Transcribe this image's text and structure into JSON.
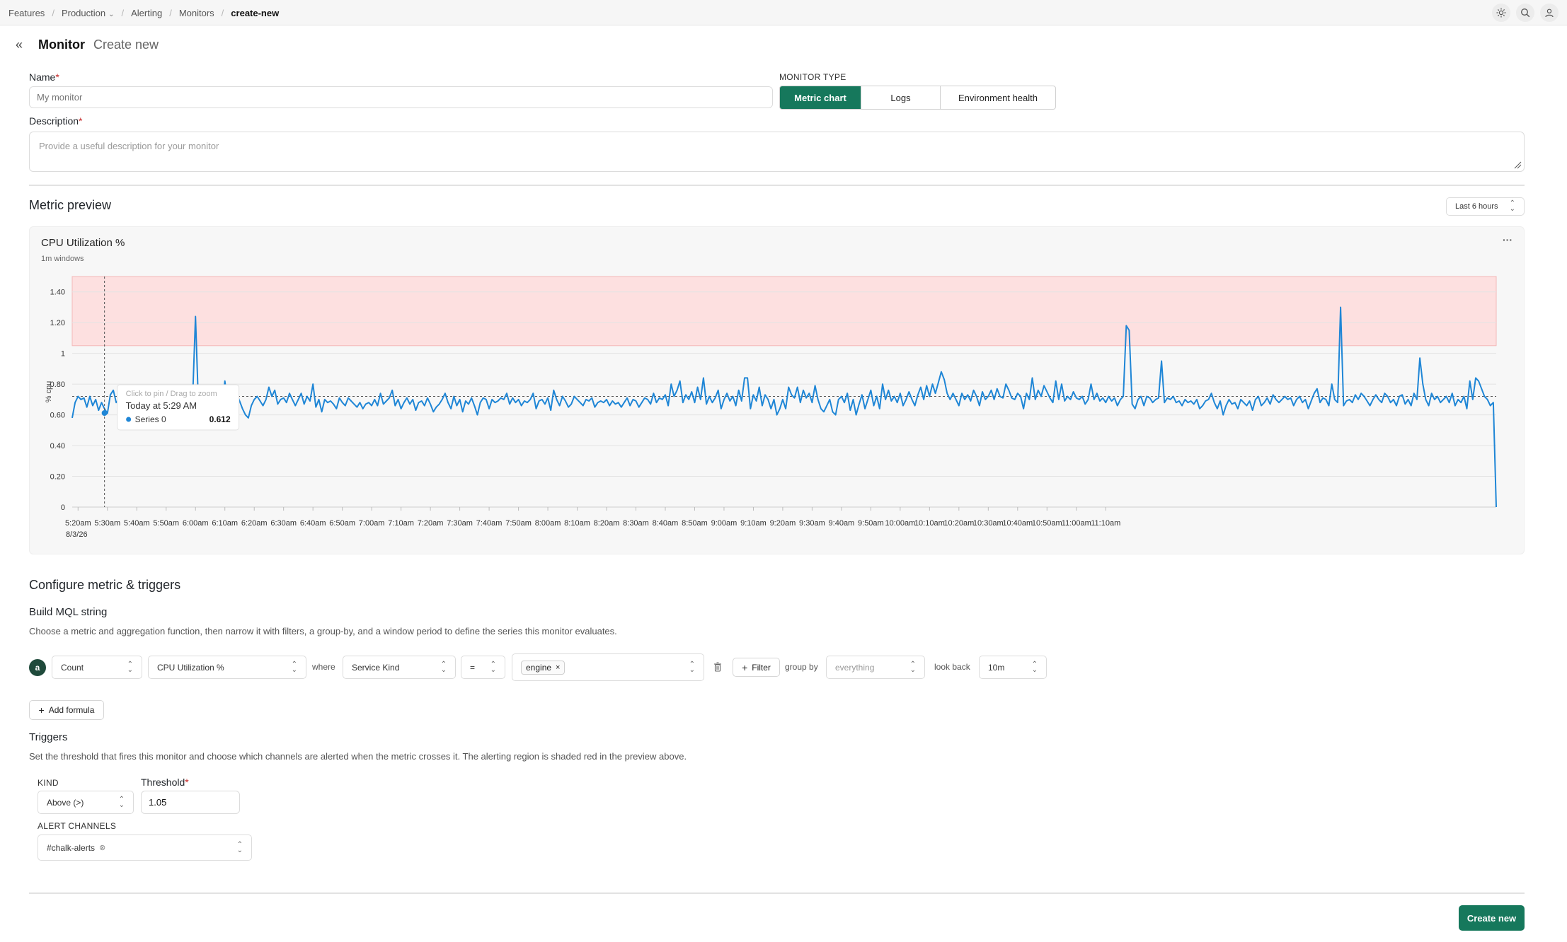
{
  "breadcrumbs": [
    {
      "label": "Features"
    },
    {
      "label": "Production"
    },
    {
      "label": "Alerting"
    },
    {
      "label": "Monitors"
    },
    {
      "label": "create-new"
    }
  ],
  "header": {
    "title": "Monitor",
    "subtitle": "Create new"
  },
  "form": {
    "name_label": "Name",
    "name_placeholder": "My monitor",
    "monitor_type_label": "MONITOR TYPE",
    "monitor_types": [
      "Metric chart",
      "Logs",
      "Environment health"
    ],
    "monitor_type_selected": "Metric chart",
    "description_label": "Description",
    "description_placeholder": "Provide a useful description for your monitor",
    "required_mark": "*"
  },
  "preview": {
    "title": "Metric preview",
    "range": "Last 6 hours",
    "more": "···"
  },
  "chart_data": {
    "type": "line",
    "title": "CPU Utilization %",
    "subtitle": "1m windows",
    "ylabel": "% cpu",
    "xlabel": "",
    "ylim": [
      0,
      1.5
    ],
    "yticks": [
      "0",
      "0.20",
      "0.40",
      "0.60",
      "0.80",
      "1",
      "1.20",
      "1.40"
    ],
    "xticks": [
      "5:20am",
      "5:30am",
      "5:40am",
      "5:50am",
      "6:00am",
      "6:10am",
      "6:20am",
      "6:30am",
      "6:40am",
      "6:50am",
      "7:00am",
      "7:10am",
      "7:20am",
      "7:30am",
      "7:40am",
      "7:50am",
      "8:00am",
      "8:10am",
      "8:20am",
      "8:30am",
      "8:40am",
      "8:50am",
      "9:00am",
      "9:10am",
      "9:20am",
      "9:30am",
      "9:40am",
      "9:50am",
      "10:00am",
      "10:10am",
      "10:20am",
      "10:30am",
      "10:40am",
      "10:50am",
      "11:00am",
      "11:10am"
    ],
    "xdate": "8/3/26",
    "threshold_band": [
      1.05,
      1.5
    ],
    "reference_line": 0.72,
    "grid": true,
    "x_start_time": "5:18am",
    "minutes_per_point": 1,
    "series": [
      {
        "name": "Series 0",
        "color": "#1f86d6",
        "values": [
          0.58,
          0.68,
          0.72,
          0.7,
          0.71,
          0.65,
          0.72,
          0.66,
          0.7,
          0.63,
          0.68,
          0.64,
          0.61,
          0.73,
          0.76,
          0.68,
          0.7,
          0.64,
          0.67,
          0.72,
          0.69,
          0.66,
          0.72,
          0.7,
          0.68,
          0.74,
          0.63,
          0.71,
          0.68,
          0.66,
          0.7,
          0.64,
          0.69,
          0.73,
          0.66,
          0.68,
          0.67,
          0.71,
          0.65,
          0.68,
          0.64,
          0.7,
          1.24,
          0.66,
          0.62,
          0.66,
          0.6,
          0.78,
          0.62,
          0.7,
          0.66,
          0.64,
          0.82,
          0.67,
          0.6,
          0.7,
          0.74,
          0.69,
          0.64,
          0.6,
          0.58,
          0.66,
          0.7,
          0.72,
          0.69,
          0.66,
          0.7,
          0.78,
          0.72,
          0.76,
          0.67,
          0.7,
          0.71,
          0.68,
          0.74,
          0.7,
          0.66,
          0.7,
          0.74,
          0.67,
          0.72,
          0.69,
          0.8,
          0.65,
          0.7,
          0.62,
          0.7,
          0.68,
          0.69,
          0.67,
          0.64,
          0.71,
          0.68,
          0.66,
          0.71,
          0.69,
          0.67,
          0.65,
          0.68,
          0.64,
          0.67,
          0.68,
          0.66,
          0.7,
          0.66,
          0.74,
          0.67,
          0.69,
          0.71,
          0.76,
          0.66,
          0.7,
          0.64,
          0.68,
          0.71,
          0.67,
          0.7,
          0.63,
          0.68,
          0.69,
          0.66,
          0.71,
          0.67,
          0.62,
          0.65,
          0.67,
          0.7,
          0.74,
          0.68,
          0.64,
          0.72,
          0.66,
          0.7,
          0.62,
          0.69,
          0.67,
          0.71,
          0.66,
          0.6,
          0.68,
          0.71,
          0.7,
          0.64,
          0.7,
          0.68,
          0.69,
          0.71,
          0.7,
          0.74,
          0.67,
          0.71,
          0.68,
          0.7,
          0.66,
          0.69,
          0.68,
          0.7,
          0.74,
          0.64,
          0.69,
          0.7,
          0.67,
          0.71,
          0.63,
          0.76,
          0.7,
          0.66,
          0.72,
          0.69,
          0.65,
          0.67,
          0.72,
          0.7,
          0.68,
          0.66,
          0.7,
          0.69,
          0.71,
          0.65,
          0.68,
          0.69,
          0.68,
          0.7,
          0.66,
          0.69,
          0.67,
          0.68,
          0.65,
          0.68,
          0.71,
          0.66,
          0.7,
          0.69,
          0.65,
          0.68,
          0.71,
          0.7,
          0.67,
          0.74,
          0.68,
          0.71,
          0.7,
          0.73,
          0.66,
          0.8,
          0.72,
          0.76,
          0.82,
          0.68,
          0.73,
          0.7,
          0.75,
          0.68,
          0.78,
          0.7,
          0.84,
          0.67,
          0.72,
          0.68,
          0.71,
          0.76,
          0.64,
          0.7,
          0.74,
          0.69,
          0.72,
          0.66,
          0.76,
          0.69,
          0.84,
          0.84,
          0.64,
          0.73,
          0.69,
          0.78,
          0.66,
          0.73,
          0.7,
          0.64,
          0.7,
          0.6,
          0.64,
          0.7,
          0.64,
          0.78,
          0.73,
          0.71,
          0.78,
          0.68,
          0.76,
          0.71,
          0.74,
          0.68,
          0.79,
          0.7,
          0.64,
          0.62,
          0.66,
          0.7,
          0.62,
          0.6,
          0.7,
          0.72,
          0.68,
          0.74,
          0.63,
          0.7,
          0.6,
          0.67,
          0.73,
          0.64,
          0.7,
          0.76,
          0.66,
          0.72,
          0.64,
          0.8,
          0.7,
          0.76,
          0.69,
          0.72,
          0.68,
          0.74,
          0.66,
          0.7,
          0.75,
          0.7,
          0.66,
          0.73,
          0.78,
          0.7,
          0.79,
          0.72,
          0.8,
          0.74,
          0.81,
          0.88,
          0.83,
          0.74,
          0.7,
          0.74,
          0.7,
          0.66,
          0.74,
          0.7,
          0.73,
          0.69,
          0.76,
          0.72,
          0.66,
          0.75,
          0.7,
          0.72,
          0.76,
          0.7,
          0.77,
          0.72,
          0.71,
          0.8,
          0.76,
          0.71,
          0.7,
          0.74,
          0.72,
          0.64,
          0.74,
          0.7,
          0.84,
          0.7,
          0.76,
          0.72,
          0.79,
          0.75,
          0.71,
          0.68,
          0.82,
          0.7,
          0.8,
          0.69,
          0.72,
          0.7,
          0.75,
          0.71,
          0.7,
          0.72,
          0.67,
          0.7,
          0.8,
          0.7,
          0.74,
          0.69,
          0.71,
          0.68,
          0.72,
          0.69,
          0.71,
          0.66,
          0.7,
          0.72,
          1.18,
          1.15,
          0.67,
          0.64,
          0.7,
          0.72,
          0.66,
          0.72,
          0.71,
          0.68,
          0.7,
          0.71,
          0.95,
          0.68,
          0.71,
          0.7,
          0.72,
          0.68,
          0.69,
          0.66,
          0.7,
          0.68,
          0.69,
          0.67,
          0.7,
          0.64,
          0.66,
          0.69,
          0.7,
          0.74,
          0.68,
          0.64,
          0.69,
          0.6,
          0.66,
          0.7,
          0.67,
          0.68,
          0.64,
          0.7,
          0.68,
          0.66,
          0.69,
          0.63,
          0.7,
          0.72,
          0.66,
          0.68,
          0.71,
          0.67,
          0.73,
          0.7,
          0.68,
          0.7,
          0.72,
          0.7,
          0.71,
          0.66,
          0.7,
          0.72,
          0.68,
          0.7,
          0.64,
          0.69,
          0.74,
          0.77,
          0.68,
          0.71,
          0.7,
          0.66,
          0.8,
          0.7,
          0.68,
          1.3,
          0.66,
          0.69,
          0.7,
          0.68,
          0.73,
          0.7,
          0.74,
          0.72,
          0.69,
          0.66,
          0.7,
          0.73,
          0.7,
          0.68,
          0.74,
          0.72,
          0.68,
          0.7,
          0.66,
          0.72,
          0.73,
          0.67,
          0.7,
          0.66,
          0.74,
          0.7,
          0.97,
          0.8,
          0.7,
          0.66,
          0.74,
          0.7,
          0.72,
          0.68,
          0.7,
          0.72,
          0.68,
          0.74,
          0.66,
          0.7,
          0.68,
          0.72,
          0.64,
          0.82,
          0.7,
          0.84,
          0.82,
          0.77,
          0.72,
          0.7,
          0.66,
          0.68,
          0.0
        ]
      }
    ],
    "tooltip": {
      "hint": "Click to pin / Drag to zoom",
      "time": "Today at 5:29 AM",
      "series": "Series 0",
      "value": "0.612"
    }
  },
  "configure": {
    "title": "Configure metric & triggers",
    "mql_title": "Build MQL string",
    "mql_desc": "Choose a metric and aggregation function, then narrow it with filters, a group-by, and a window period to define the series this monitor evaluates.",
    "row_badge": "a",
    "aggregation": "Count",
    "metric": "CPU Utilization %",
    "where": "where",
    "filter_key": "Service Kind",
    "operator": "=",
    "filter_value": "engine",
    "filter_button": "Filter",
    "group_by": "group by",
    "group_by_placeholder": "everything",
    "look_back": "look back",
    "look_back_value": "10m",
    "add_formula": "Add formula"
  },
  "triggers": {
    "title": "Triggers",
    "desc": "Set the threshold that fires this monitor and choose which channels are alerted when the metric crosses it. The alerting region is shaded red in the preview above.",
    "kind_label": "KIND",
    "kind_value": "Above (>)",
    "threshold_label": "Threshold",
    "threshold_value": "1.05",
    "channels_label": "ALERT CHANNELS",
    "channel": "#chalk-alerts"
  },
  "actions": {
    "create": "Create new"
  }
}
